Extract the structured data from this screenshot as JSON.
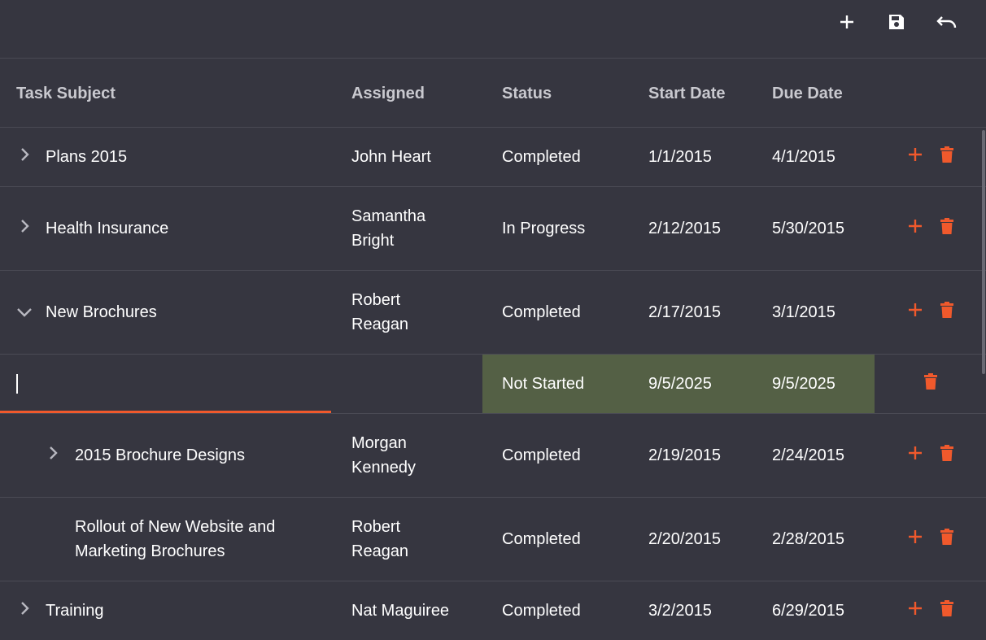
{
  "toolbar": {
    "add_icon": "plus-icon",
    "save_icon": "save-icon",
    "undo_icon": "undo-icon"
  },
  "columns": {
    "subject": "Task Subject",
    "assigned": "Assigned",
    "status": "Status",
    "start": "Start Date",
    "due": "Due Date"
  },
  "rows": [
    {
      "subject": "Plans 2015",
      "assigned": "John Heart",
      "status": "Completed",
      "start": "1/1/2015",
      "due": "4/1/2015",
      "expander": "chevron-right"
    },
    {
      "subject": "Health Insurance",
      "assigned": "Samantha Bright",
      "status": "In Progress",
      "start": "2/12/2015",
      "due": "5/30/2015",
      "expander": "chevron-right"
    },
    {
      "subject": "New Brochures",
      "assigned": "Robert Reagan",
      "status": "Completed",
      "start": "2/17/2015",
      "due": "3/1/2015",
      "expander": "chevron-down"
    },
    {
      "subject": "",
      "assigned": "",
      "status": "Not Started",
      "start": "9/5/2025",
      "due": "9/5/2025",
      "editing": true
    },
    {
      "subject": "2015 Brochure Designs",
      "assigned": "Morgan Kennedy",
      "status": "Completed",
      "start": "2/19/2015",
      "due": "2/24/2015",
      "expander": "chevron-right"
    },
    {
      "subject": "Rollout of New Website and Marketing Brochures",
      "assigned": "Robert Reagan",
      "status": "Completed",
      "start": "2/20/2015",
      "due": "2/28/2015"
    },
    {
      "subject": "Training",
      "assigned": "Nat Maguiree",
      "status": "Completed",
      "start": "3/2/2015",
      "due": "6/29/2015",
      "expander": "chevron-right"
    }
  ],
  "colors": {
    "background": "#363640",
    "accent": "#f0592c",
    "edit_highlight": "#546045"
  }
}
